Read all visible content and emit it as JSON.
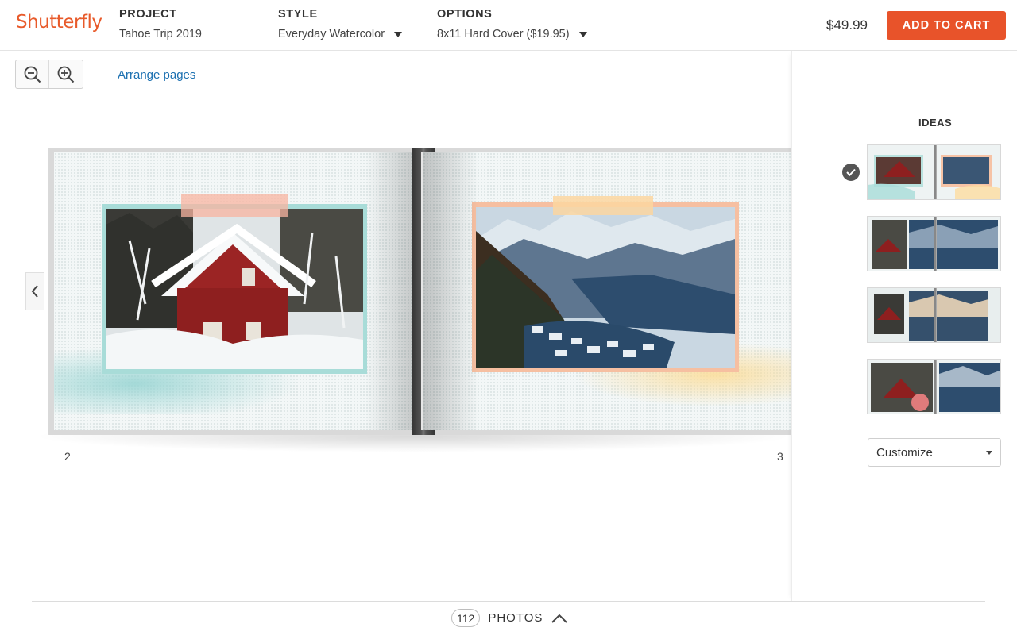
{
  "brand": {
    "logo_text": "Shutterfly",
    "accent": "#e8532a"
  },
  "header": {
    "project": {
      "label": "PROJECT",
      "value": "Tahoe Trip 2019"
    },
    "style": {
      "label": "STYLE",
      "value": "Everyday Watercolor"
    },
    "options": {
      "label": "OPTIONS",
      "value": "8x11 Hard Cover ($19.95)"
    },
    "price": "$49.99",
    "add_to_cart": "ADD TO CART"
  },
  "toolbar": {
    "zoom_out_icon": "zoom-out-icon",
    "zoom_in_icon": "zoom-in-icon",
    "arrange_pages": "Arrange pages"
  },
  "book": {
    "left_page_number": "2",
    "right_page_number": "3",
    "left_photo": "snowy red cabin",
    "right_photo": "alpine valley village"
  },
  "sidebar": {
    "title": "IDEAS",
    "selected_index": 0,
    "layouts": 4,
    "customize": "Customize"
  },
  "bottom": {
    "photo_count": "112",
    "photos_label": "PHOTOS"
  }
}
